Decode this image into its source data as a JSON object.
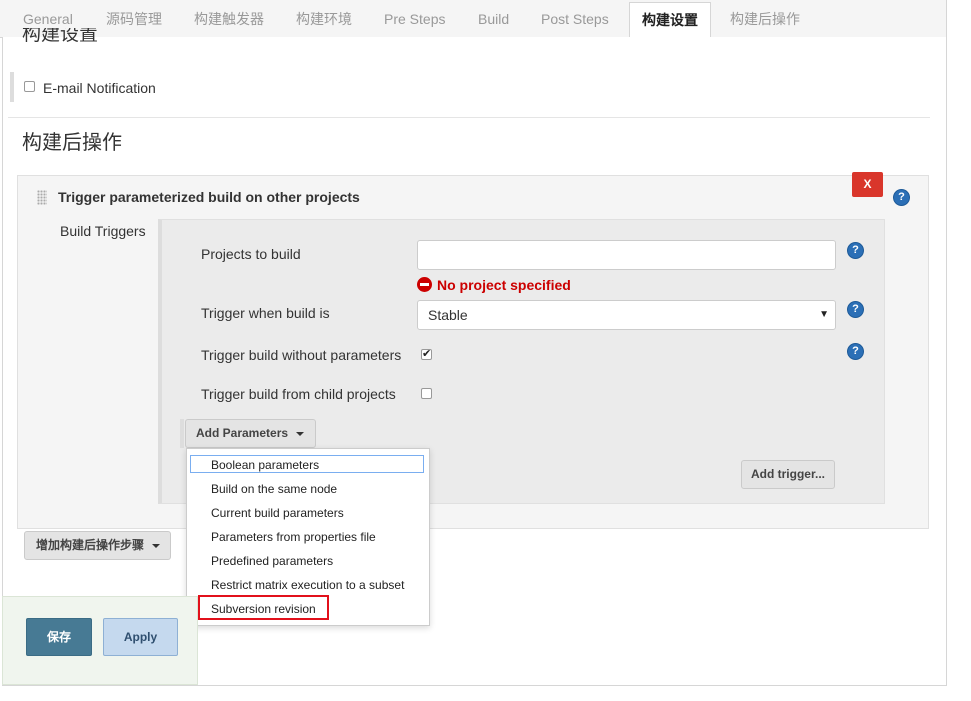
{
  "tabs": [
    {
      "label": "General"
    },
    {
      "label": "源码管理"
    },
    {
      "label": "构建触发器"
    },
    {
      "label": "构建环境"
    },
    {
      "label": "Pre Steps"
    },
    {
      "label": "Build"
    },
    {
      "label": "Post Steps"
    },
    {
      "label": "构建设置"
    },
    {
      "label": "构建后操作"
    }
  ],
  "active_tab": "构建设置",
  "build_settings": {
    "title": "构建设置",
    "email_notification_label": "E-mail Notification",
    "email_notification_checked": false
  },
  "post_build": {
    "title": "构建后操作",
    "step": {
      "title": "Trigger parameterized build on other projects",
      "delete_label": "X",
      "build_triggers_label": "Build Triggers",
      "projects_to_build_label": "Projects to build",
      "projects_to_build_value": "",
      "error_text": "No project specified",
      "trigger_when_label": "Trigger when build is",
      "trigger_when_value": "Stable",
      "without_params_label": "Trigger build without parameters",
      "without_params_checked": true,
      "from_child_label": "Trigger build from child projects",
      "from_child_checked": false,
      "add_parameters_label": "Add Parameters",
      "add_trigger_label": "Add trigger..."
    },
    "add_step_label": "增加构建后操作步骤"
  },
  "parameters_menu": [
    {
      "label": "Boolean parameters"
    },
    {
      "label": "Build on the same node"
    },
    {
      "label": "Current build parameters"
    },
    {
      "label": "Parameters from properties file"
    },
    {
      "label": "Predefined parameters"
    },
    {
      "label": "Restrict matrix execution to a subset"
    },
    {
      "label": "Subversion revision"
    }
  ],
  "footer": {
    "save_label": "保存",
    "apply_label": "Apply"
  },
  "colors": {
    "error": "#cc0000",
    "delete_button": "#d9362b",
    "save_button": "#477a94",
    "apply_button": "#c5d9ee",
    "highlight": "#e2101b",
    "help_icon": "#2b6fb6"
  }
}
